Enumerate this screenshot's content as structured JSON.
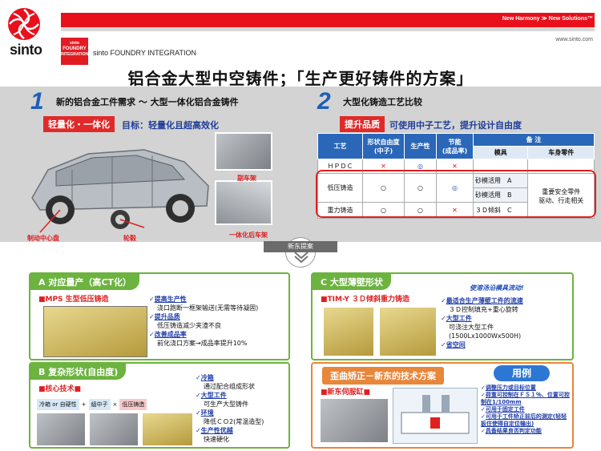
{
  "header": {
    "logo_text": "sinto",
    "tagline": "New Harmony ≫ New Solutions™",
    "website": "www.sinto.com",
    "badge_lines": [
      "sinto",
      "FOUNDRY",
      "INTEGRATION"
    ],
    "company": "sinto FOUNDRY INTEGRATION",
    "brand_red": "#e8101b"
  },
  "title": "铝合金大型中空铸件；「生产更好铸件的方案」",
  "section1": {
    "number": "1",
    "heading": "新的铝合金工件需求 ～ 大型一体化铝合金铸件",
    "tag": "轻量化・一体化",
    "goal": "目标：轻量化且超高效化",
    "labels": [
      "副车架",
      "制动中心盘",
      "轮毂",
      "一体化后车架"
    ]
  },
  "section2": {
    "number": "2",
    "heading": "大型化铸造工艺比较",
    "tag": "提升品质",
    "goal": "可使用中子工艺，提升设计自由度",
    "table": {
      "headers": [
        "工艺",
        "形状自由度\n(中子)",
        "生产性",
        "节能\n(成品率)",
        "备 注"
      ],
      "sub_headers": [
        "模具",
        "车身零件"
      ],
      "rows": [
        {
          "process": "ＨＰＤＣ",
          "shape": "✕",
          "prod": "◎",
          "energy": "✕",
          "mold": "",
          "note": ""
        },
        {
          "process": "低压铸造",
          "shape": "○",
          "prod": "○",
          "energy": "◎",
          "mold": "砂模活用　A",
          "note": "重要安全零件\n驱动、行走相关"
        },
        {
          "process": "",
          "shape": "",
          "prod": "",
          "energy": "",
          "mold": "砂模活用　B",
          "note": ""
        },
        {
          "process": "重力铸造",
          "shape": "○",
          "prod": "○",
          "energy": "✕",
          "mold": "３Ｄ倾斜　C",
          "note": ""
        }
      ]
    }
  },
  "divider": "新东提案",
  "panelA": {
    "title": "A 对应量产（高CT化）",
    "subtitle": "■MPS 生型低压铸造",
    "bullets": [
      {
        "head": "提高生产性",
        "body": [
          "浇口跑断一框架输送(无需等待凝固)"
        ]
      },
      {
        "head": "提升品质",
        "body": [
          "低压铸造减少夹渣不良"
        ]
      },
      {
        "head": "改善成品率",
        "body": [
          "前化浇口方案→成品率提升10%"
        ]
      }
    ]
  },
  "panelB": {
    "title": "B 复杂形状(自由度)",
    "subtitle": "■核心技术■",
    "chips": [
      "冷箱 or 自硬性",
      "+",
      "組中子",
      "×",
      "低压铸造"
    ],
    "bullets": [
      {
        "head": "冷箱",
        "body": [
          "通过配合组成形状"
        ]
      },
      {
        "head": "大型工件",
        "body": [
          "可生产大型铸件"
        ]
      },
      {
        "head": "环境",
        "body": [
          "降低ＣＯ2(常温造型)"
        ]
      },
      {
        "head": "生产性优越",
        "body": [
          "快速硬化"
        ]
      }
    ]
  },
  "panelC": {
    "title": "C 大型薄壁形状",
    "subtitle": "■TIM-Y ３Ｄ倾斜重力铸造",
    "note": "使溶汤沿模具流动!",
    "bullets": [
      {
        "head": "最适合生产薄壁工件的流速",
        "body": [
          "３Ｄ控制填充+重心旋转"
        ]
      },
      {
        "head": "大型工件",
        "body": [
          "可浇注大型工件",
          "(1500Lx1000Wx500H)"
        ]
      },
      {
        "head": "省空间",
        "body": []
      }
    ]
  },
  "panelD": {
    "title": "歪曲矫正－新东的技术方案",
    "example_tag": "用例",
    "subtitle": "■新东伺服缸■",
    "bullets": [
      "调整压力或目标位置",
      "荷重可控制在ＦＳ１％、位置可控制在1/100mm",
      "可用于固定工件",
      "可用于工件矫正前后的测定(轻轻扳住使得自定位输出)",
      "具备结果良否判定功能"
    ]
  }
}
